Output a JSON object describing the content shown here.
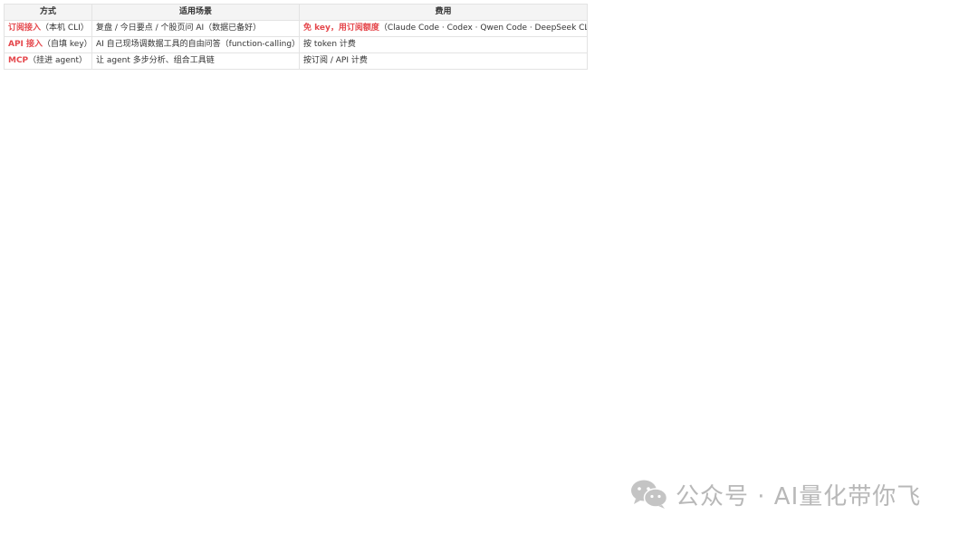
{
  "table": {
    "headers": [
      "方式",
      "适用场景",
      "费用"
    ],
    "rows": [
      {
        "method_hl": "订阅接入",
        "method_note": "（本机 CLI）",
        "scene": "复盘 / 今日要点 / 个股页问 AI（数据已备好）",
        "cost_hl": "免 key，用订阅额度",
        "cost_note": "（Claude Code · Codex · Qwen Code · DeepSeek CLI）"
      },
      {
        "method_hl": "API 接入",
        "method_note": "（自填 key）",
        "scene": "AI 自己现场调数据工具的自由问答（function-calling）",
        "cost_hl": "",
        "cost_note": "按 token 计费"
      },
      {
        "method_hl": "MCP",
        "method_note": "（挂进 agent）",
        "scene": "让 agent 多步分析、组合工具链",
        "cost_hl": "",
        "cost_note": "按订阅 / API 计费"
      }
    ]
  },
  "watermark": {
    "icon": "wechat-icon",
    "text": "公众号 · AI量化带你飞"
  },
  "colors": {
    "highlight": "#e5484d",
    "header_bg": "#f4f4f4",
    "border": "#e3e3e3",
    "watermark": "#b8b8b8"
  }
}
